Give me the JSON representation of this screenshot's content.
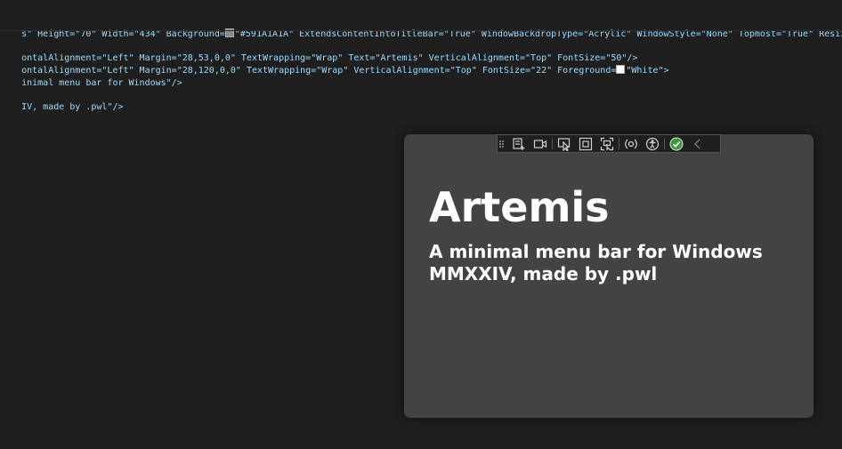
{
  "editor": {
    "lines": [
      {
        "t": "s\" Height=\"70\" Width=\"434\" Background=",
        "swatch": "#591A1A1A",
        "t2": "\"#591A1A1A\" ExtendsContentIntoTitleBar=\"True\" WindowBackdropType=\"Acrylic\" WindowStyle=\"None\" Topmost=\"True\" ResizeM"
      },
      {
        "t": "ontalAlignment=\"Left\" Margin=\"28,53,0,0\" TextWrapping=\"Wrap\" Text=\"Artemis\" VerticalAlignment=\"Top\" FontSize=\"50\"/>"
      },
      {
        "t": "ontalAlignment=\"Left\" Margin=\"28,120,0,0\" TextWrapping=\"Wrap\" VerticalAlignment=\"Top\" FontSize=\"22\" Foreground=",
        "swatch": "#FFFFFF",
        "t2": "\"White\">"
      },
      {
        "t": "inimal menu bar for Windows\"/>"
      },
      {
        "t": "IV, made by .pwl\"/>"
      }
    ]
  },
  "preview": {
    "title": "Artemis",
    "subtitle": "A minimal menu bar for Windows\nMMXXIV, made by .pwl",
    "background": "#434343"
  },
  "toolbar": {
    "buttons": [
      {
        "name": "live-visual-tree-icon"
      },
      {
        "name": "record-icon"
      },
      {
        "name": "select-element-icon"
      },
      {
        "name": "display-layout-adorners-icon"
      },
      {
        "name": "track-focus-icon"
      },
      {
        "name": "binding-failures-icon"
      },
      {
        "name": "accessibility-icon"
      },
      {
        "name": "hot-reload-ok-icon"
      },
      {
        "name": "collapse-chevron-icon"
      }
    ]
  }
}
